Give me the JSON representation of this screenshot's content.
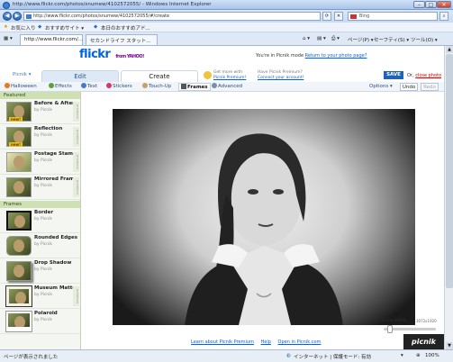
{
  "window": {
    "title": "http://www.flickr.com/photos/snumew/4102572055/ - Windows Internet Explorer"
  },
  "address": {
    "url": "http://www.flickr.com/photos/snumew/4102572055/#/create",
    "search_engine": "Bing"
  },
  "favorites": {
    "favorites_label": "お気に入り",
    "suggested_sites": "おすすめサイト ▾",
    "web_slice": "本日のおすすめアド..."
  },
  "tabs": [
    {
      "label": "http://www.flickr.com/..."
    },
    {
      "label": "セカンドライフ スタット..."
    }
  ],
  "browser_tools": {
    "page": "ページ(P) ▾",
    "safety": "セーフティ(S) ▾",
    "tools": "ツール(O) ▾"
  },
  "flickr": {
    "logo_1": "flickr",
    "logo_2": "from YAHOO!",
    "picnik_mode": "You're in Picnik mode",
    "return_link": "Return to your photo page?"
  },
  "modes": {
    "picnik_menu": "Picnik ▾",
    "edit": "Edit",
    "create": "Create",
    "promo_1_line1": "Get more with",
    "promo_1_line2": "Picnik Premium!",
    "promo_2_line1": "Have Picnik Premium?",
    "promo_2_line2": "Connect your account!",
    "save": "SAVE",
    "or": "Or,",
    "close": "close photo"
  },
  "toolbar": {
    "halloween": "Halloween",
    "effects": "Effects",
    "text": "Text",
    "stickers": "Stickers",
    "touchup": "Touch-Up",
    "frames": "Frames",
    "advanced": "Advanced",
    "options": "Options ▾",
    "undo": "Undo",
    "redo": "Redo"
  },
  "panel": {
    "featured_header": "Featured",
    "frames_header": "Frames",
    "by": "by Picnik",
    "new_badge": "new!",
    "premium": "premium",
    "featured": [
      {
        "name": "Before & After"
      },
      {
        "name": "Reflection"
      },
      {
        "name": "Postage Stamp"
      },
      {
        "name": "Mirrored Frame"
      }
    ],
    "frames": [
      {
        "name": "Border"
      },
      {
        "name": "Rounded Edges"
      },
      {
        "name": "Drop Shadow"
      },
      {
        "name": "Museum Matte"
      },
      {
        "name": "Polaroid"
      }
    ]
  },
  "zoom": {
    "label": "Zoom 100%",
    "size": "3072x1920"
  },
  "footer": {
    "learn": "Learn about Picnik Premium",
    "help": "Help",
    "open": "Open in Picnik.com"
  },
  "brand": "picnik",
  "status": {
    "left": "ページが表示されました",
    "zone": "インターネット | 保護モード: 有効",
    "zoom": "100%"
  }
}
